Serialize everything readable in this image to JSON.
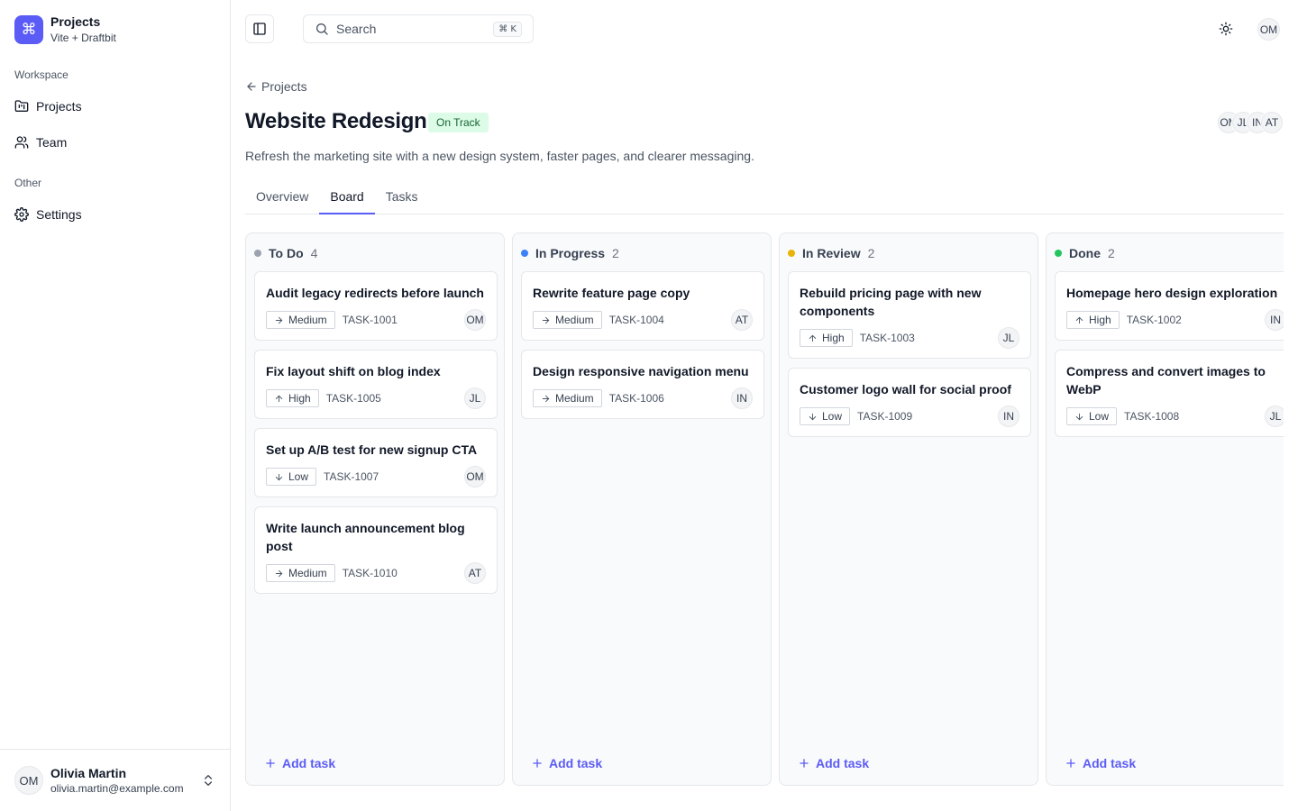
{
  "brand": {
    "name": "Projects",
    "subtitle": "Vite + Draftbit",
    "logo_icon": "command-icon",
    "logo_glyph": "⌘",
    "color": "#5b5bf6"
  },
  "sidebar": {
    "groups": [
      {
        "label": "Workspace",
        "items": [
          {
            "label": "Projects",
            "icon": "folder-kanban-icon"
          },
          {
            "label": "Team",
            "icon": "users-icon"
          }
        ]
      },
      {
        "label": "Other",
        "items": [
          {
            "label": "Settings",
            "icon": "gear-icon"
          }
        ]
      }
    ],
    "user": {
      "initials": "OM",
      "name": "Olivia Martin",
      "email": "olivia.martin@example.com"
    }
  },
  "topbar": {
    "search_placeholder": "Search",
    "shortcut": "⌘ K",
    "avatar": "OM"
  },
  "project": {
    "breadcrumb": "Projects",
    "title": "Website Redesign",
    "status": "On Track",
    "description": "Refresh the marketing site with a new design system, faster pages, and clearer messaging.",
    "members": [
      "OM",
      "JL",
      "IN",
      "AT"
    ]
  },
  "tabs": [
    {
      "label": "Overview",
      "active": false
    },
    {
      "label": "Board",
      "active": true
    },
    {
      "label": "Tasks",
      "active": false
    }
  ],
  "board": {
    "add_task_label": "Add task",
    "columns": [
      {
        "title": "To Do",
        "count": "4",
        "color": "#9ca3af",
        "cards": [
          {
            "title": "Audit legacy redirects before launch",
            "priority": "Medium",
            "id": "TASK-1001",
            "assignee": "OM"
          },
          {
            "title": "Fix layout shift on blog index",
            "priority": "High",
            "id": "TASK-1005",
            "assignee": "JL"
          },
          {
            "title": "Set up A/B test for new signup CTA",
            "priority": "Low",
            "id": "TASK-1007",
            "assignee": "OM"
          },
          {
            "title": "Write launch announcement blog post",
            "priority": "Medium",
            "id": "TASK-1010",
            "assignee": "AT"
          }
        ]
      },
      {
        "title": "In Progress",
        "count": "2",
        "color": "#3b82f6",
        "cards": [
          {
            "title": "Rewrite feature page copy",
            "priority": "Medium",
            "id": "TASK-1004",
            "assignee": "AT"
          },
          {
            "title": "Design responsive navigation menu",
            "priority": "Medium",
            "id": "TASK-1006",
            "assignee": "IN"
          }
        ]
      },
      {
        "title": "In Review",
        "count": "2",
        "color": "#eab308",
        "cards": [
          {
            "title": "Rebuild pricing page with new components",
            "priority": "High",
            "id": "TASK-1003",
            "assignee": "JL"
          },
          {
            "title": "Customer logo wall for social proof",
            "priority": "Low",
            "id": "TASK-1009",
            "assignee": "IN"
          }
        ]
      },
      {
        "title": "Done",
        "count": "2",
        "color": "#22c55e",
        "cards": [
          {
            "title": "Homepage hero design exploration",
            "priority": "High",
            "id": "TASK-1002",
            "assignee": "IN"
          },
          {
            "title": "Compress and convert images to WebP",
            "priority": "Low",
            "id": "TASK-1008",
            "assignee": "JL"
          }
        ]
      }
    ]
  }
}
